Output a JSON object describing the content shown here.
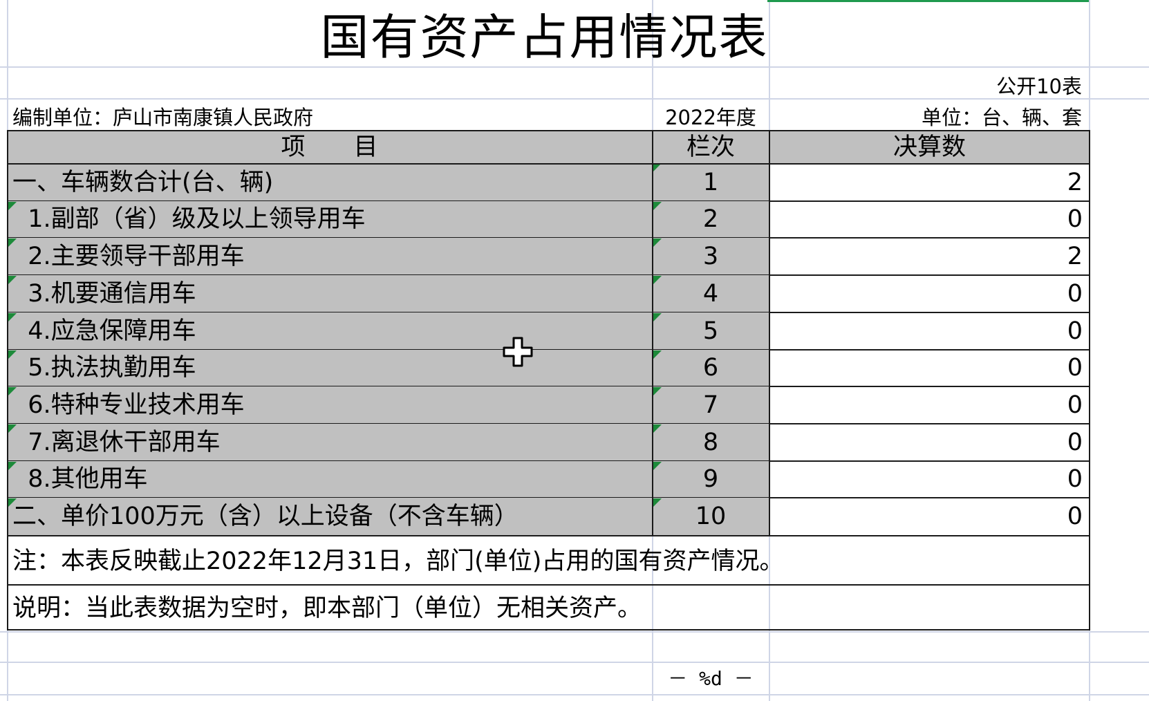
{
  "sheet": {
    "title": "国有资产占用情况表",
    "table_code": "公开10表",
    "compiler": "编制单位：庐山市南康镇人民政府",
    "year": "2022年度",
    "unit": "单位：台、辆、套",
    "header": {
      "item": "项　　目",
      "line_no": "栏次",
      "amount": "决算数"
    },
    "rows": [
      {
        "item": "一、车辆数合计(台、辆)",
        "line_no": "1",
        "amount": "2"
      },
      {
        "item": "  1.副部（省）级及以上领导用车",
        "line_no": "2",
        "amount": "0"
      },
      {
        "item": "  2.主要领导干部用车",
        "line_no": "3",
        "amount": "2"
      },
      {
        "item": "  3.机要通信用车",
        "line_no": "4",
        "amount": "0"
      },
      {
        "item": "  4.应急保障用车",
        "line_no": "5",
        "amount": "0"
      },
      {
        "item": "  5.执法执勤用车",
        "line_no": "6",
        "amount": "0"
      },
      {
        "item": "  6.特种专业技术用车",
        "line_no": "7",
        "amount": "0"
      },
      {
        "item": "  7.离退休干部用车",
        "line_no": "8",
        "amount": "0"
      },
      {
        "item": "  8.其他用车",
        "line_no": "9",
        "amount": "0"
      },
      {
        "item": "二、单价100万元（含）以上设备（不含车辆）",
        "line_no": "10",
        "amount": "0"
      }
    ],
    "note": "注：本表反映截止2022年12月31日，部门(单位)占用的国有资产情况。",
    "explanation": "说明：当此表数据为空时，即本部门（单位）无相关资产。",
    "page_footer": "－ %d －"
  },
  "colors": {
    "grid": "#cfd5e6",
    "header_fill": "#c0c0c0",
    "border": "#1a1a1a",
    "selection": "#1f9a4e",
    "comment_marker": "#1d8a3a"
  },
  "cursor_icon": "move-cursor-icon"
}
